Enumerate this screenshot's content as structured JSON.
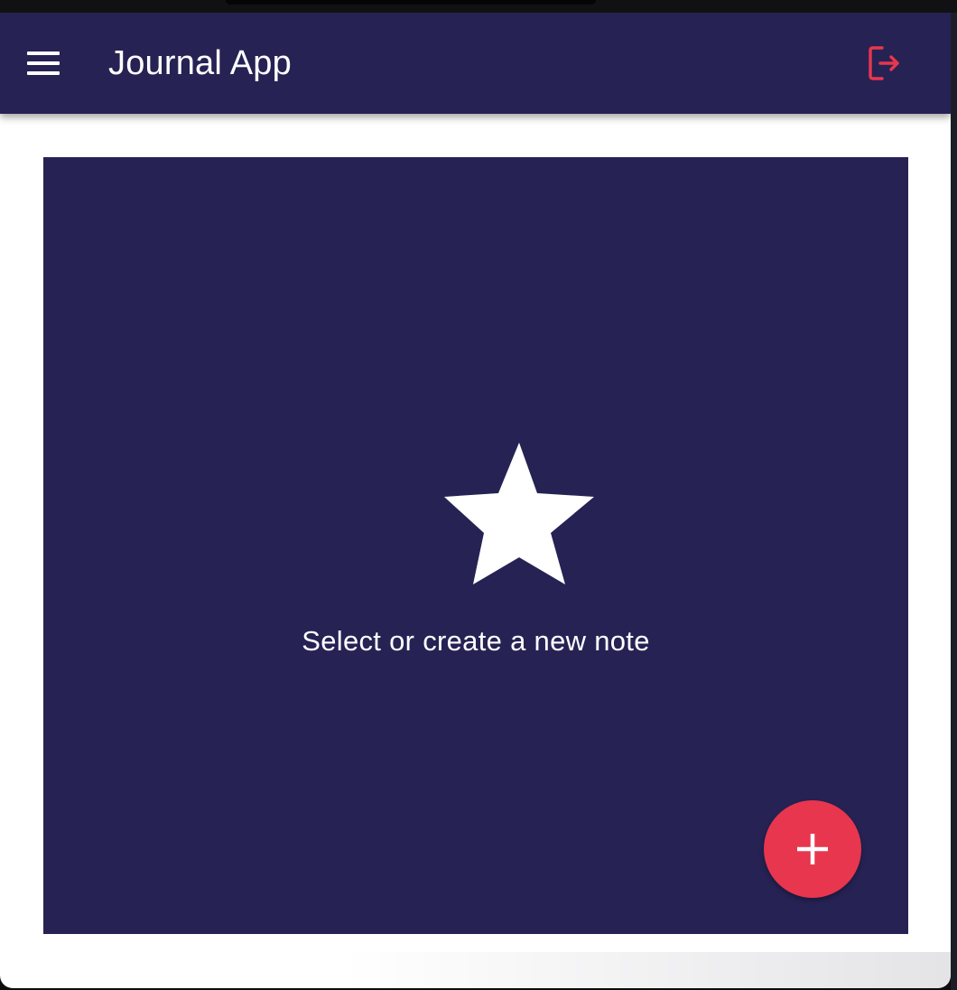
{
  "app": {
    "title": "Journal App"
  },
  "appbar": {
    "menu_icon": "hamburger-menu-icon",
    "logout_icon": "logout-icon"
  },
  "main": {
    "empty_state": {
      "icon": "star-icon",
      "message": "Select or create a new note"
    },
    "fab": {
      "icon": "plus-icon"
    }
  },
  "colors": {
    "primary": "#262254",
    "accent": "#e8364e",
    "background": "#ffffff",
    "text_on_primary": "#ffffff"
  }
}
